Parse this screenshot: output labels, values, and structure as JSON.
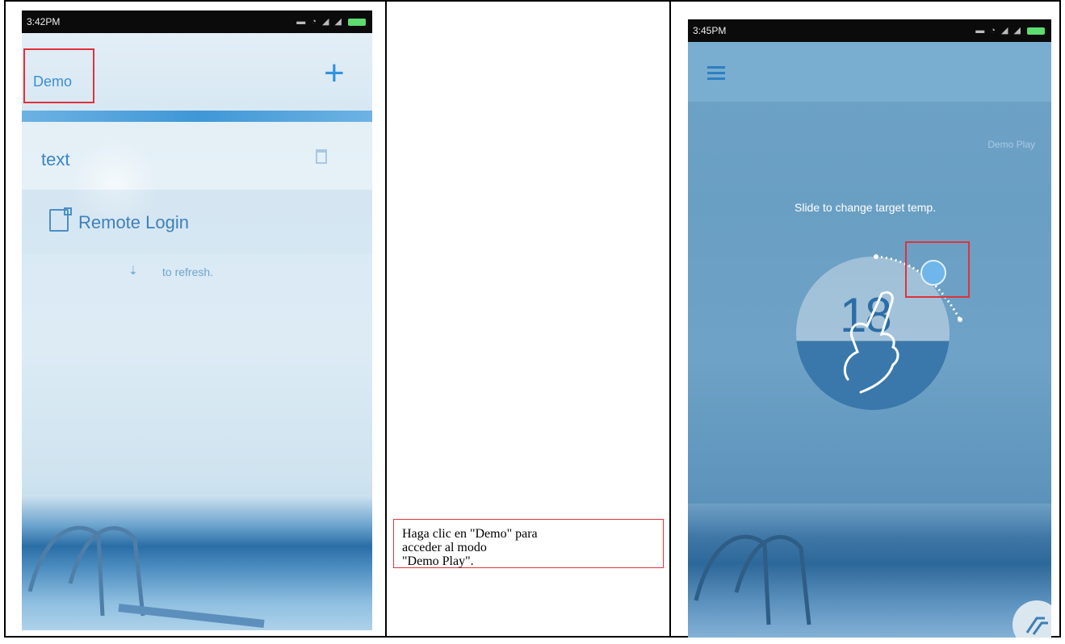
{
  "phone1": {
    "status_time": "3:42PM",
    "demo_label": "Demo",
    "add_symbol": "+",
    "list_item_label": "text",
    "remote_login_label": "Remote Login",
    "refresh_hint": "to refresh.",
    "icons": [
      "add-icon",
      "trash-icon",
      "remote-login-icon",
      "refresh-icon"
    ]
  },
  "caption": {
    "line1": "Haga clic en \"Demo\" para",
    "line2": "acceder al modo",
    "line3": "\"Demo Play\"."
  },
  "phone2": {
    "status_time": "3:45PM",
    "mode_label": "Demo Play",
    "hint": "Slide to change target temp.",
    "temperature": "18",
    "icons": [
      "menu-icon",
      "slider-handle-icon",
      "hand-gesture-icon",
      "corner-icon"
    ]
  },
  "colors": {
    "highlight": "#e0323a",
    "accent": "#2f93de"
  }
}
